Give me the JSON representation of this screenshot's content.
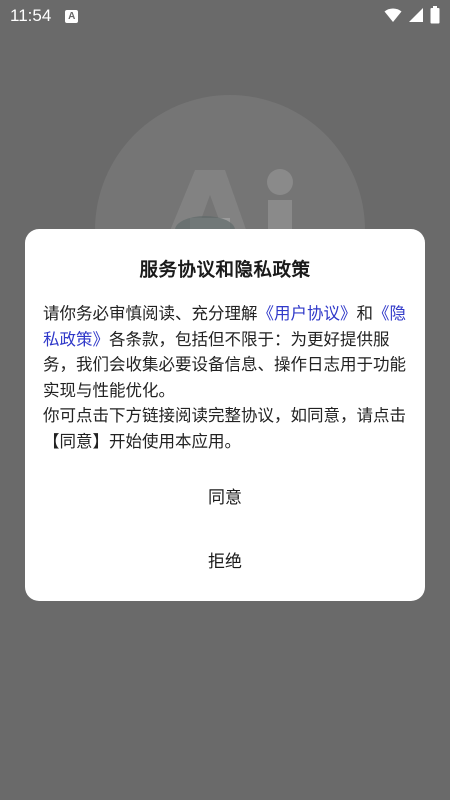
{
  "status_bar": {
    "time": "11:54",
    "notification_icon_letter": "A",
    "icons": [
      "wifi-icon",
      "signal-icon",
      "battery-icon"
    ]
  },
  "background": {
    "logo_icon": "ai-logo-icon"
  },
  "dialog": {
    "title": "服务协议和隐私政策",
    "body": {
      "text_1": "请你务必审慎阅读、充分理解",
      "link_user_agreement": "《用户协议》",
      "text_2": "和",
      "link_privacy_policy": "《隐私政策》",
      "text_3": "各条款，包括但不限于：为更好提供服务，我们会收集必要设备信息、操作日志用于功能实现与性能优化。",
      "paragraph_2": "你可点击下方链接阅读完整协议，如同意，请点击【同意】开始使用本应用。"
    },
    "agree_label": "同意",
    "refuse_label": "拒绝"
  },
  "colors": {
    "link": "#2f38c9",
    "dialog_background": "#ffffff",
    "scrim": "#676767"
  }
}
